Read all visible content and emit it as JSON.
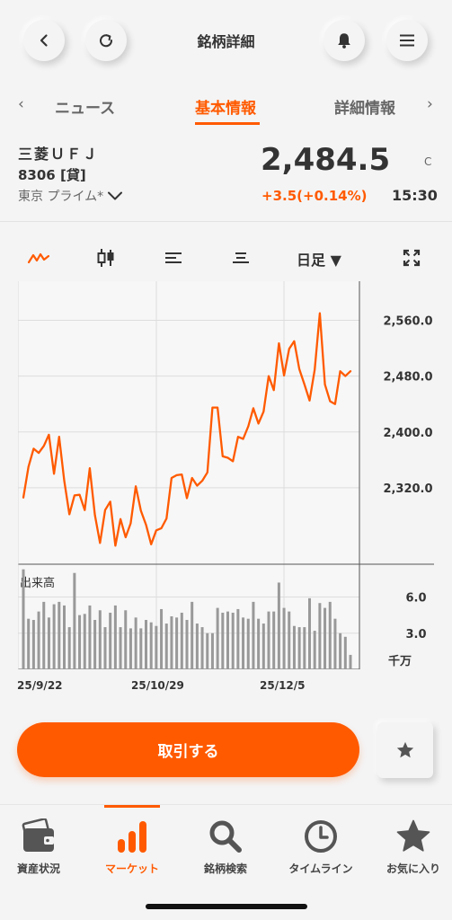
{
  "header": {
    "title": "銘柄詳細",
    "back_icon": "chevron-left-icon",
    "refresh_icon": "refresh-icon",
    "bell_icon": "bell-icon",
    "menu_icon": "hamburger-menu-icon"
  },
  "tabs": {
    "prev_arrow": "‹",
    "next_arrow": "›",
    "items": [
      {
        "label": "ニュース",
        "active": false
      },
      {
        "label": "基本情報",
        "active": true
      },
      {
        "label": "詳細情報",
        "active": false
      }
    ]
  },
  "stock": {
    "name": "三菱ＵＦＪ",
    "code": "8306 [貸]",
    "market": "東京 プライム*",
    "price": "2,484.5",
    "price_flag": "C",
    "change": "+3.5(+0.14%)",
    "time": "15:30"
  },
  "chart_toolbar": {
    "period_label": "日足 ▼",
    "icons": [
      "line-chart-icon",
      "candlestick-icon",
      "indicator-left-icon",
      "indicator-center-icon",
      "fullscreen-icon"
    ]
  },
  "chart_data": {
    "type": "line",
    "price_axis": {
      "ticks": [
        "2,560.0",
        "2,480.0",
        "2,400.0",
        "2,320.0"
      ],
      "ylim": [
        2213,
        2616
      ]
    },
    "volume_axis": {
      "label": "出来高",
      "unit": "千万",
      "ticks": [
        "6.0",
        "3.0"
      ],
      "ylim": [
        0,
        8.5
      ]
    },
    "x_labels": [
      "25/9/22",
      "25/10/29",
      "25/12/5"
    ],
    "price_series": [
      2306,
      2350,
      2376,
      2370,
      2380,
      2396,
      2340,
      2393,
      2330,
      2282,
      2309,
      2310,
      2288,
      2348,
      2281,
      2241,
      2288,
      2300,
      2237,
      2275,
      2249,
      2269,
      2322,
      2287,
      2267,
      2239,
      2259,
      2262,
      2276,
      2334,
      2338,
      2339,
      2305,
      2334,
      2323,
      2330,
      2342,
      2435,
      2435,
      2365,
      2363,
      2358,
      2393,
      2390,
      2408,
      2434,
      2412,
      2429,
      2480,
      2460,
      2527,
      2481,
      2519,
      2530,
      2490,
      2468,
      2445,
      2489,
      2570,
      2468,
      2444,
      2440,
      2487,
      2480,
      2487
    ],
    "volume_series": [
      8.3,
      4.2,
      4.1,
      4.8,
      5.6,
      4.3,
      5.4,
      5.6,
      5.3,
      3.5,
      8.0,
      4.5,
      4.6,
      5.3,
      4.1,
      4.9,
      3.5,
      4.7,
      5.3,
      3.5,
      4.9,
      3.4,
      4.3,
      3.4,
      4.1,
      3.9,
      3.6,
      5.0,
      3.8,
      4.4,
      4.3,
      4.7,
      4.1,
      5.6,
      3.8,
      3.5,
      3.0,
      3.0,
      5.1,
      4.7,
      4.8,
      4.7,
      5.0,
      4.3,
      4.2,
      5.6,
      4.2,
      3.8,
      4.8,
      4.8,
      7.2,
      5.1,
      4.8,
      3.6,
      3.5,
      3.5,
      5.9,
      3.2,
      5.5,
      5.1,
      5.6,
      4.2,
      3.0,
      2.7,
      1.2
    ]
  },
  "actions": {
    "trade_label": "取引する",
    "favorite_icon": "star-icon"
  },
  "bottom_nav": [
    {
      "label": "資産状況",
      "icon": "wallet-icon",
      "active": false
    },
    {
      "label": "マーケット",
      "icon": "bar-chart-icon",
      "active": true
    },
    {
      "label": "銘柄検索",
      "icon": "search-icon",
      "active": false
    },
    {
      "label": "タイムライン",
      "icon": "clock-icon",
      "active": false
    },
    {
      "label": "お気に入り",
      "icon": "star-icon",
      "active": false
    }
  ],
  "colors": {
    "accent": "#ff5a00",
    "background": "#f4f4f4",
    "text": "#333333",
    "volume_bar": "#999999"
  }
}
